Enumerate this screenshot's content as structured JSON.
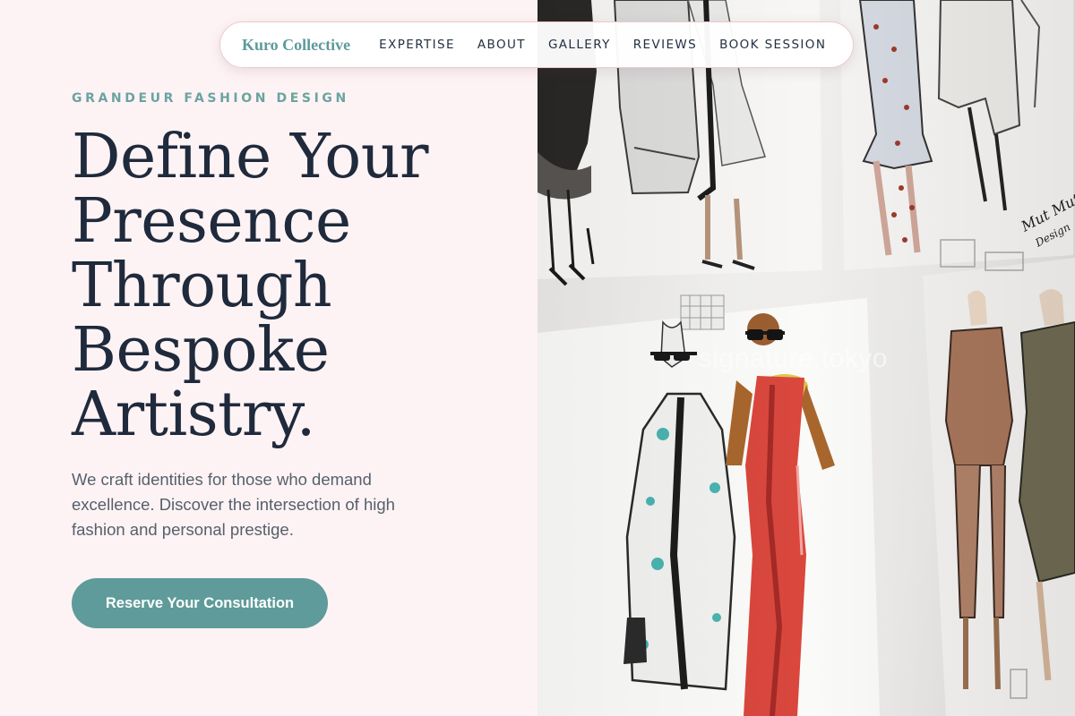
{
  "nav": {
    "brand": "Kuro Collective",
    "links": [
      {
        "label": "EXPERTISE"
      },
      {
        "label": "ABOUT"
      },
      {
        "label": "GALLERY"
      },
      {
        "label": "REVIEWS"
      },
      {
        "label": "BOOK SESSION"
      }
    ]
  },
  "hero": {
    "kicker": "GRANDEUR FASHION DESIGN",
    "headline_lines": [
      "Define Your",
      "Presence",
      "Through",
      "Bespoke",
      "Artistry."
    ],
    "description_lines": [
      "We craft identities for those who demand",
      "excellence. Discover the intersection of high",
      "fashion and personal prestige."
    ],
    "cta_label": "Reserve Your Consultation"
  },
  "image": {
    "watermark": "signature.tokyo",
    "sketch_signature": "Mut Mut Design"
  },
  "colors": {
    "accent": "#5e9b9a",
    "background": "#fef3f4",
    "heading": "#1f2a3c",
    "body_text": "#56606c"
  }
}
